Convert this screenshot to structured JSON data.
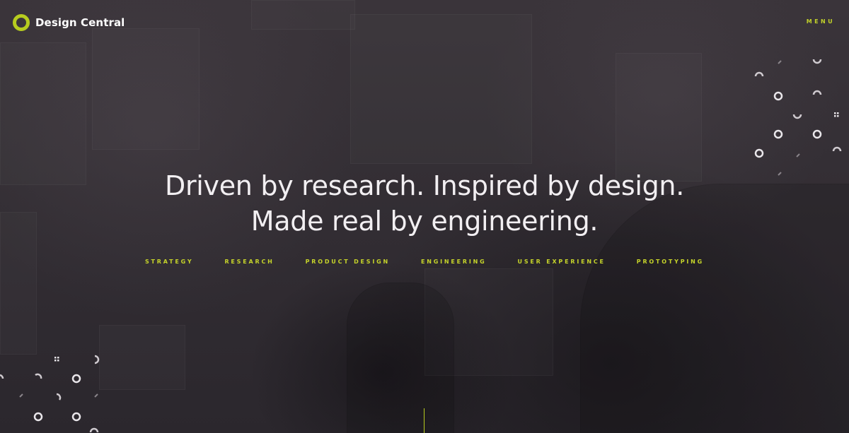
{
  "brand": {
    "name": "Design Central",
    "accent_color": "#b7cc1f",
    "logo_icon": "ring-icon"
  },
  "nav": {
    "menu_label": "MENU"
  },
  "hero": {
    "headline_line1": "Driven by research. Inspired by design.",
    "headline_line2": "Made real by engineering.",
    "services": [
      "STRATEGY",
      "RESEARCH",
      "PRODUCT DESIGN",
      "ENGINEERING",
      "USER EXPERIENCE",
      "PROTOTYPING"
    ]
  }
}
